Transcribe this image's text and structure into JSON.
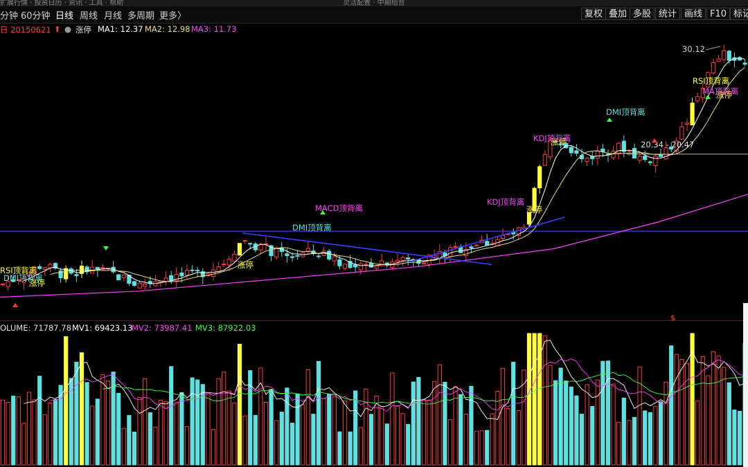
{
  "topbar": {
    "left_text": "扩展行情 · 投资日历 · 资讯 · 工具 · 帮助",
    "title": "灵活配置 · 中期组合"
  },
  "periods": [
    {
      "label": "分钟",
      "active": false
    },
    {
      "label": "60分钟",
      "active": false
    },
    {
      "label": "日线",
      "active": true
    },
    {
      "label": "周线",
      "active": false
    },
    {
      "label": "月线",
      "active": false
    },
    {
      "label": "多周期",
      "active": false
    },
    {
      "label": "更多〉",
      "active": false
    }
  ],
  "tool_buttons": [
    "复权",
    "叠加",
    "多股",
    "统计",
    "画线",
    "F10",
    "标记"
  ],
  "price_legend": {
    "date": "日 20150621",
    "limit_label": "涨停",
    "ma1": "MA1: 12.37",
    "ma2": "MA2: 12.98",
    "ma3": "MA3: 11.73"
  },
  "volume_legend": {
    "volume": "OLUME: 71787.78",
    "mv1": "MV1: 69423.13",
    "mv2": "MV2: 73987.41",
    "mv3": "MV3: 87922.03"
  },
  "colors": {
    "up": "#ff3b3b",
    "down": "#5fe0e0",
    "limit": "#ffff40",
    "ma1": "#ffffff",
    "ma2": "#e8e080",
    "ma3": "#ff40ff",
    "mv3": "#40ff40",
    "blue_line": "#3c3cff",
    "label_yellow": "#ffff40",
    "label_cyan": "#5fe0e0",
    "label_magenta": "#ff40ff"
  },
  "chart_data": [
    {
      "type": "candlestick",
      "title": "",
      "series": [
        {
          "name": "MA1",
          "value": 12.37
        },
        {
          "name": "MA2",
          "value": 12.98
        },
        {
          "name": "MA3",
          "value": 11.73
        }
      ],
      "annotations": [
        {
          "text": "30.12"
        },
        {
          "text": "20.34 - 20.47"
        },
        {
          "text": "涨停"
        },
        {
          "text": "涨停"
        },
        {
          "text": "涨停"
        },
        {
          "text": "涨停"
        },
        {
          "text": "涨停"
        },
        {
          "text": "RSI顶背离"
        },
        {
          "text": "RSI顶背离"
        },
        {
          "text": "DMI顶背离"
        },
        {
          "text": "DMI顶背离"
        },
        {
          "text": "DMI顶背离"
        },
        {
          "text": "KDJ顶背离"
        },
        {
          "text": "KDJ顶背离"
        },
        {
          "text": "MACD顶背离"
        },
        {
          "text": "MA顶背离"
        }
      ],
      "close_path": [
        {
          "x": 0,
          "close": 9.6
        },
        {
          "x": 40,
          "close": 10.6
        },
        {
          "x": 60,
          "close": 11.3
        },
        {
          "x": 90,
          "close": 10.5
        },
        {
          "x": 130,
          "close": 10.9
        },
        {
          "x": 160,
          "close": 10.6
        },
        {
          "x": 200,
          "close": 9.6
        },
        {
          "x": 240,
          "close": 10.3
        },
        {
          "x": 280,
          "close": 10.4
        },
        {
          "x": 320,
          "close": 11.3
        },
        {
          "x": 350,
          "close": 13.3
        },
        {
          "x": 380,
          "close": 12.7
        },
        {
          "x": 410,
          "close": 11.9
        },
        {
          "x": 450,
          "close": 12.3
        },
        {
          "x": 480,
          "close": 12.0
        },
        {
          "x": 510,
          "close": 10.7
        },
        {
          "x": 540,
          "close": 11.5
        },
        {
          "x": 570,
          "close": 11.7
        },
        {
          "x": 600,
          "close": 11.6
        },
        {
          "x": 640,
          "close": 12.2
        },
        {
          "x": 680,
          "close": 12.9
        },
        {
          "x": 720,
          "close": 13.4
        },
        {
          "x": 760,
          "close": 14.2
        },
        {
          "x": 780,
          "close": 19.3
        },
        {
          "x": 800,
          "close": 21.8
        },
        {
          "x": 820,
          "close": 21.2
        },
        {
          "x": 840,
          "close": 19.9
        },
        {
          "x": 870,
          "close": 20.7
        },
        {
          "x": 900,
          "close": 21.0
        },
        {
          "x": 930,
          "close": 19.9
        },
        {
          "x": 960,
          "close": 20.4
        },
        {
          "x": 990,
          "close": 22.9
        },
        {
          "x": 1010,
          "close": 25.7
        },
        {
          "x": 1040,
          "close": 28.7
        },
        {
          "x": 1060,
          "close": 28.2
        },
        {
          "x": 1080,
          "close": 27.4
        }
      ],
      "ma3_path": [
        {
          "x": 0,
          "value": 8.6
        },
        {
          "x": 200,
          "value": 9.1
        },
        {
          "x": 400,
          "value": 10.1
        },
        {
          "x": 600,
          "value": 11.1
        },
        {
          "x": 800,
          "value": 12.6
        },
        {
          "x": 950,
          "value": 14.8
        },
        {
          "x": 1080,
          "value": 17.1
        }
      ]
    },
    {
      "type": "bar",
      "title": "",
      "series": [
        {
          "name": "OLUME",
          "value": 71787.78
        },
        {
          "name": "MV1",
          "value": 69423.13
        },
        {
          "name": "MV2",
          "value": 73987.41
        },
        {
          "name": "MV3",
          "value": 87922.03
        }
      ]
    }
  ]
}
